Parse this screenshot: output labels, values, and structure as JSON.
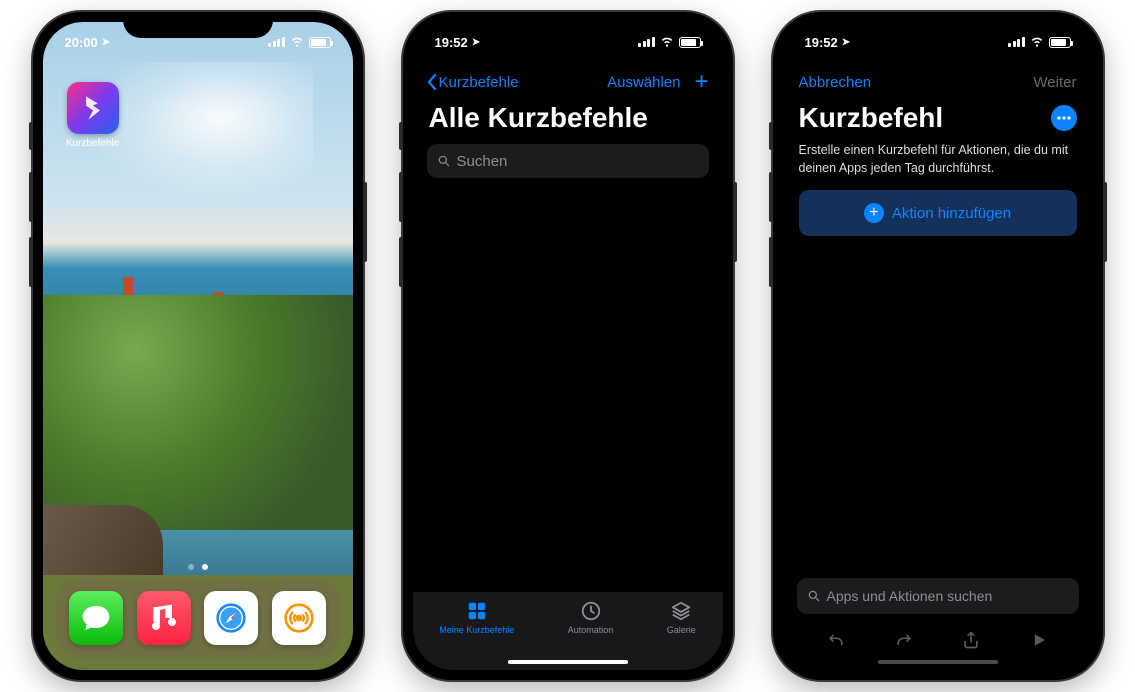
{
  "phone1": {
    "status_time": "20:00",
    "app_label": "Kurzbefehle",
    "dock": [
      "messages",
      "music",
      "safari",
      "overcast"
    ]
  },
  "phone2": {
    "status_time": "19:52",
    "back_label": "Kurzbefehle",
    "select_label": "Auswählen",
    "page_title": "Alle Kurzbefehle",
    "search_placeholder": "Suchen",
    "tabs": {
      "mine": "Meine Kurzbefehle",
      "automation": "Automation",
      "gallery": "Galerie"
    }
  },
  "phone3": {
    "status_time": "19:52",
    "cancel_label": "Abbrechen",
    "next_label": "Weiter",
    "page_title": "Kurzbefehl",
    "description": "Erstelle einen Kurzbefehl für Aktionen, die du mit deinen Apps jeden Tag durchführst.",
    "add_action_label": "Aktion hinzufügen",
    "search_placeholder": "Apps und Aktionen suchen"
  },
  "colors": {
    "ios_blue": "#0a84ff",
    "bg_dark": "#000000",
    "search_bg": "#1c1c1e"
  }
}
